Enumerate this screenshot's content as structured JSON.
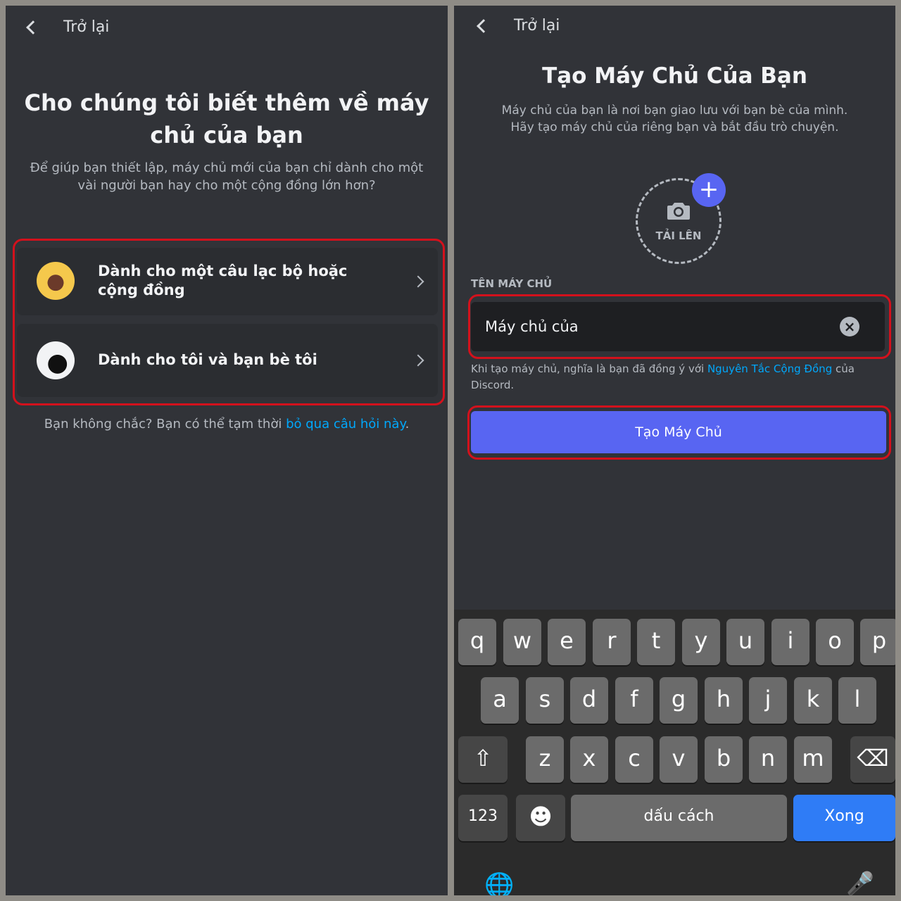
{
  "left": {
    "back_label": "Trở lại",
    "title": "Cho chúng tôi biết thêm về máy chủ của bạn",
    "subtitle": "Để giúp bạn thiết lập, máy chủ mới của bạn chỉ dành cho một vài người bạn hay cho một cộng đồng lớn hơn?",
    "options": [
      {
        "label": "Dành cho một câu lạc bộ hoặc cộng đồng",
        "icon": "door-icon"
      },
      {
        "label": "Dành cho tôi và bạn bè tôi",
        "icon": "friends-icon"
      }
    ],
    "skip_prefix": "Bạn không chắc? Bạn có thể tạm thời ",
    "skip_link": "bỏ qua câu hỏi này",
    "skip_suffix": "."
  },
  "right": {
    "back_label": "Trở lại",
    "title": "Tạo Máy Chủ Của Bạn",
    "subtitle": "Máy chủ của bạn là nơi bạn giao lưu với bạn bè của mình. Hãy tạo máy chủ của riêng bạn và bắt đầu trò chuyện.",
    "upload_label": "TẢI LÊN",
    "plus_symbol": "+",
    "field_label": "TÊN MÁY CHỦ",
    "field_value": "Máy chủ của",
    "clear_symbol": "×",
    "terms_prefix": "Khi tạo máy chủ, nghĩa là bạn đã đồng ý với ",
    "terms_link": "Nguyên Tắc Cộng Đồng",
    "terms_suffix": " của Discord.",
    "create_button": "Tạo Máy Chủ"
  },
  "keyboard": {
    "row1": [
      "q",
      "w",
      "e",
      "r",
      "t",
      "y",
      "u",
      "i",
      "o",
      "p"
    ],
    "row2": [
      "a",
      "s",
      "d",
      "f",
      "g",
      "h",
      "j",
      "k",
      "l"
    ],
    "row3": [
      "z",
      "x",
      "c",
      "v",
      "b",
      "n",
      "m"
    ],
    "numbers": "123",
    "space": "dấu cách",
    "done": "Xong",
    "shift_symbol": "⇧",
    "backspace_symbol": "⌫",
    "emoji_symbol": "☻",
    "globe_symbol": "🌐",
    "mic_symbol": "🎤"
  },
  "colors": {
    "brand": "#5865f2",
    "link": "#00a8fc",
    "highlight": "#d3111c"
  }
}
